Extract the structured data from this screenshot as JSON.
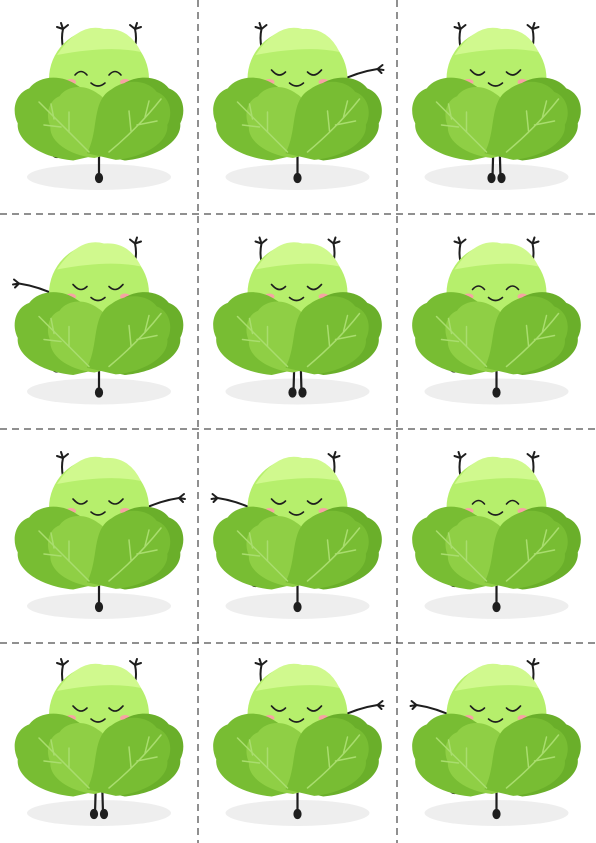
{
  "sheet": {
    "background": "#ffffff",
    "cut_line_color": "#222222",
    "columns": 3,
    "rows": 4
  },
  "colors": {
    "head": "#b6ef6c",
    "head_light": "#d0f98e",
    "leaf_dark": "#6aaf2a",
    "leaf_mid": "#78bd33",
    "leaf_light": "#8fcf45",
    "vein": "#a9dd6e",
    "outline": "#1e1e1e",
    "blush": "#f7a3a3",
    "shadow": "#eeeeee"
  },
  "cards": [
    {
      "id": 1,
      "arms": [
        "up",
        "up"
      ],
      "legs": "kick-left",
      "eyes": "happy"
    },
    {
      "id": 2,
      "arms": [
        "up",
        "side"
      ],
      "legs": "kick-right",
      "eyes": "closed"
    },
    {
      "id": 3,
      "arms": [
        "up",
        "up"
      ],
      "legs": "stand",
      "eyes": "closed"
    },
    {
      "id": 4,
      "arms": [
        "side",
        "up"
      ],
      "legs": "kick-left",
      "eyes": "closed"
    },
    {
      "id": 5,
      "arms": [
        "up",
        "up"
      ],
      "legs": "stand",
      "eyes": "closed"
    },
    {
      "id": 6,
      "arms": [
        "up",
        "up"
      ],
      "legs": "kick-left",
      "eyes": "happy"
    },
    {
      "id": 7,
      "arms": [
        "up",
        "side"
      ],
      "legs": "kick-right",
      "eyes": "closed"
    },
    {
      "id": 8,
      "arms": [
        "side",
        "up"
      ],
      "legs": "kick-left",
      "eyes": "closed"
    },
    {
      "id": 9,
      "arms": [
        "up",
        "up"
      ],
      "legs": "kick-left",
      "eyes": "happy"
    },
    {
      "id": 10,
      "arms": [
        "up",
        "up"
      ],
      "legs": "stand",
      "eyes": "closed"
    },
    {
      "id": 11,
      "arms": [
        "up",
        "side"
      ],
      "legs": "kick-right",
      "eyes": "closed"
    },
    {
      "id": 12,
      "arms": [
        "side",
        "up"
      ],
      "legs": "kick-left",
      "eyes": "closed"
    }
  ]
}
